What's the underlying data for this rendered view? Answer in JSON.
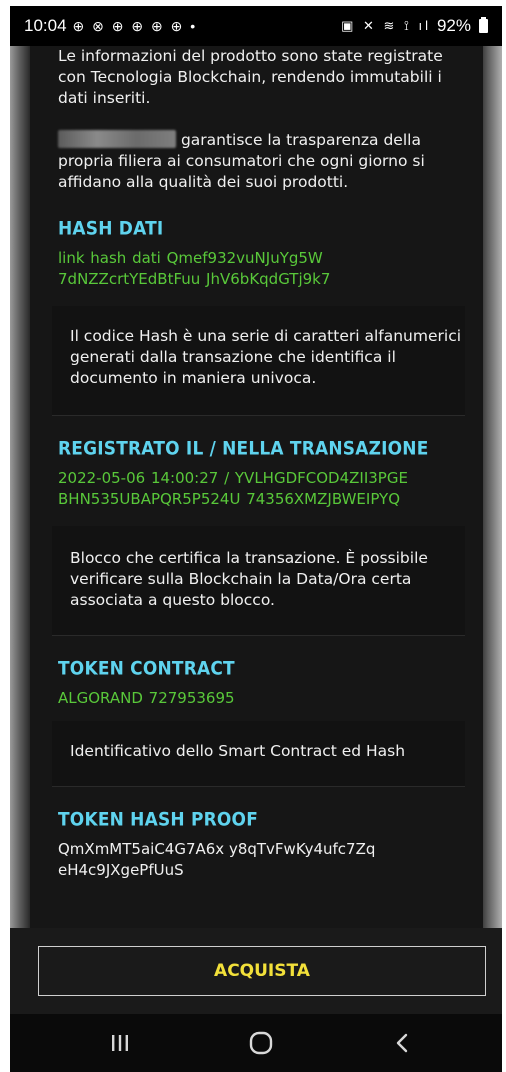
{
  "status_bar": {
    "time": "10:04",
    "left_icons": "⊕ ⊗ ⊕ ⊕ ⊕ ⊕ •",
    "right_icons": "▣ ✕ ≋ ⟟ ıl",
    "battery": "92%"
  },
  "intro": {
    "paragraph1": "Le informazioni del prodotto sono state registrate con Tecnologia Blockchain, rendendo immutabili i dati inseriti.",
    "paragraph2": "garantisce la trasparenza della propria filiera ai consumatori che ogni giorno si affidano alla qualità dei suoi prodotti."
  },
  "sections": {
    "hash_dati": {
      "title": "HASH DATI",
      "value_line1": "link hash dati Qmef932vuNJuYg5W",
      "value_line2": "7dNZZcrtYEdBtFuu   JhV6bKqdGTj9k7",
      "description": "Il codice Hash è una serie di caratteri alfanumerici generati dalla transazione che identifica il documento in maniera univoca."
    },
    "registrato": {
      "title": "REGISTRATO IL / NELLA TRANSAZIONE",
      "value_line1": "2022-05-06 14:00:27 / YVLHGDFCOD4ZII3PGE",
      "value_line2": "BHN535UBAPQR5P524U   74356XMZJBWEIPYQ",
      "description": "Blocco che certifica la transazione. È possibile verificare sulla Blockchain la Data/Ora certa associata a questo blocco."
    },
    "token_contract": {
      "title": "TOKEN CONTRACT",
      "value": "ALGORAND 727953695",
      "description": "Identificativo dello Smart Contract ed Hash"
    },
    "token_hash_proof": {
      "title": "TOKEN HASH PROOF",
      "value_line1": "QmXmMT5aiC4G7A6x   y8qTvFwKy4ufc7Zq",
      "value_line2": "eH4c9JXgePfUuS"
    }
  },
  "buy_button": {
    "label": "ACQUISTA"
  },
  "nav_bar": {
    "recents_icon": "recents-icon",
    "home_icon": "home-icon",
    "back_icon": "back-icon"
  },
  "colors": {
    "accent_title": "#5fd3ee",
    "value_green": "#59c83a",
    "button_text": "#f2e03a",
    "background": "#161616"
  }
}
